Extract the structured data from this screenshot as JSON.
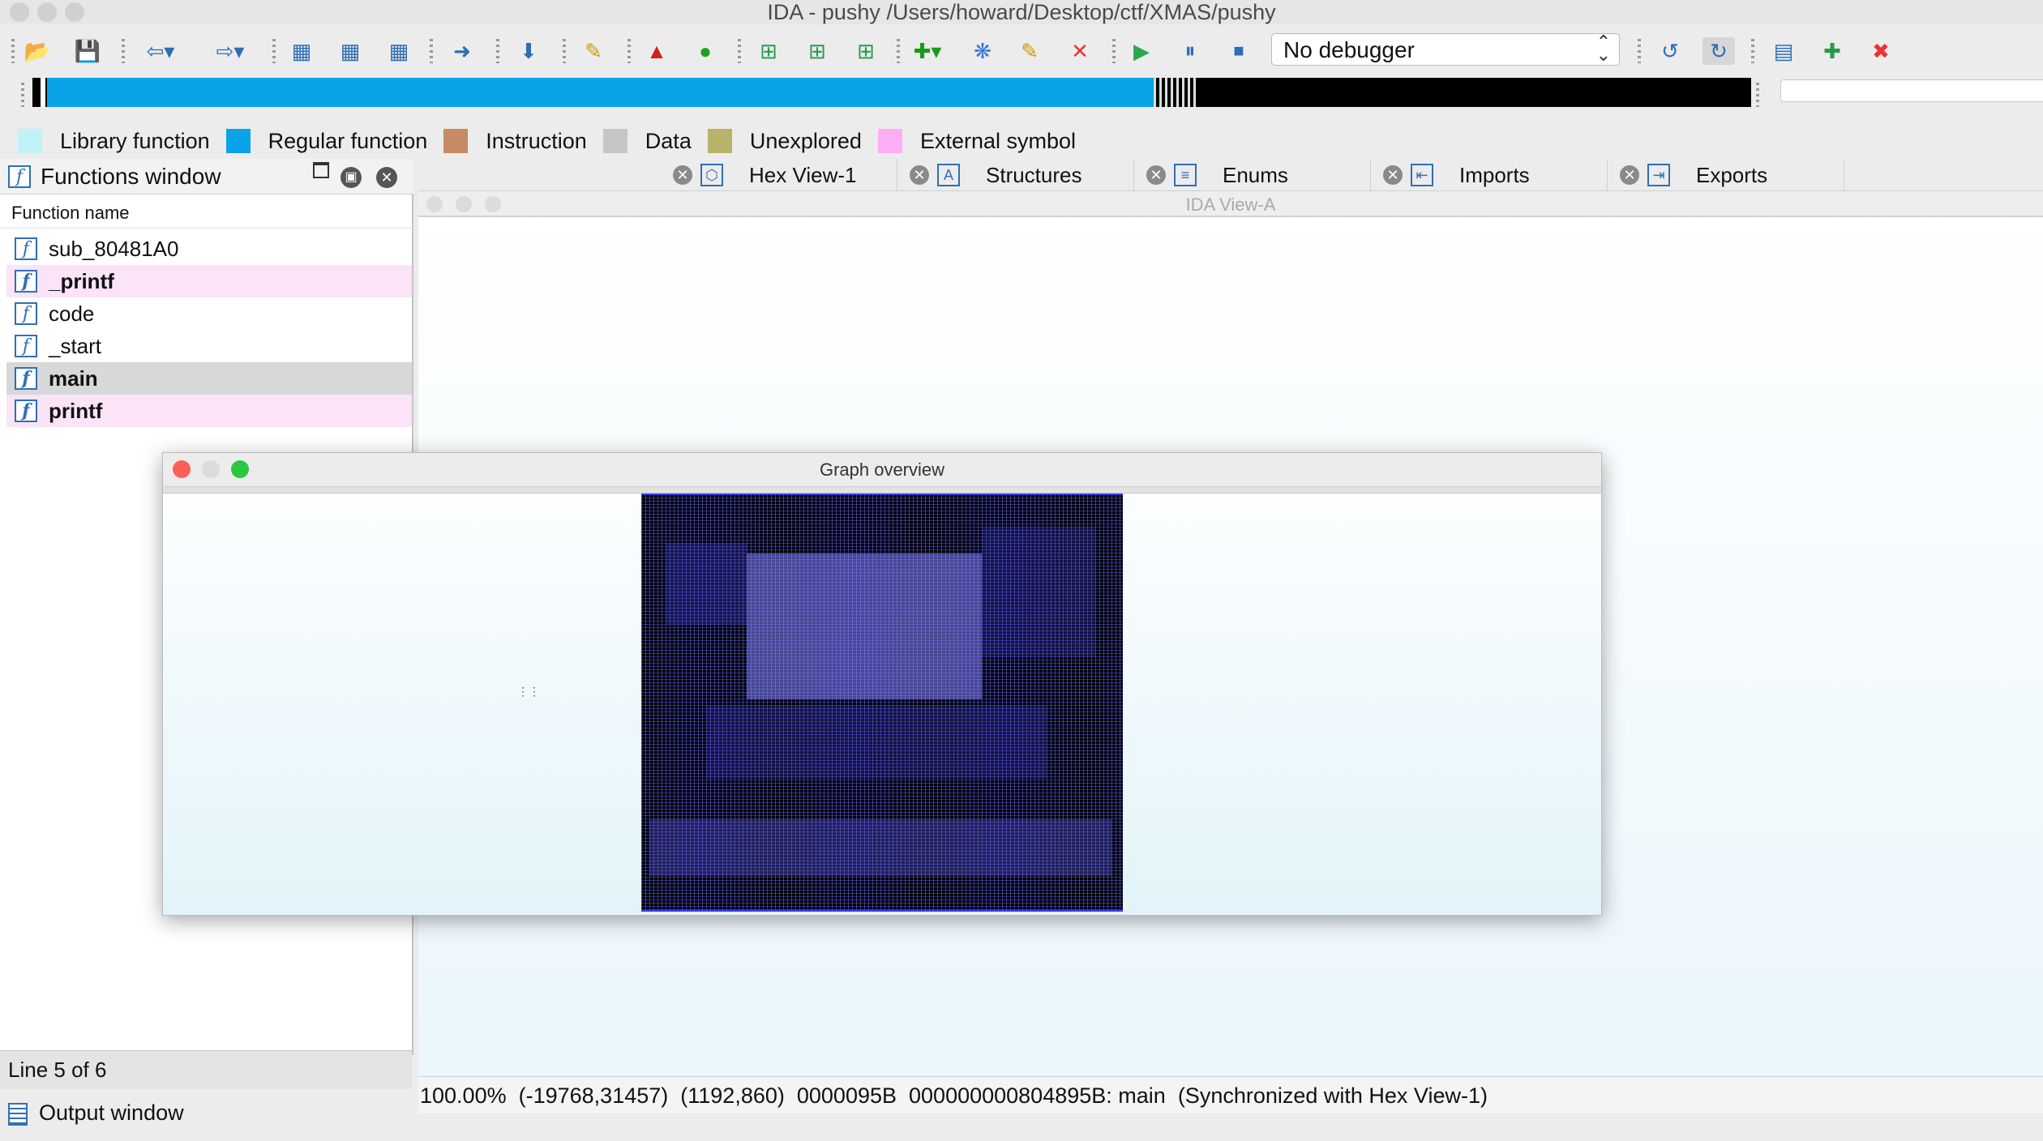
{
  "window": {
    "title": "IDA - pushy /Users/howard/Desktop/ctf/XMAS/pushy"
  },
  "toolbar": {
    "debugger_select": "No debugger",
    "icons": [
      "open-icon",
      "save-icon",
      "back-icon",
      "forward-icon",
      "text-search-icon",
      "binary-search-icon",
      "immediate-search-icon",
      "jump-icon",
      "jump-down-icon",
      "hide-icon",
      "warning-icon",
      "green-circle-icon",
      "add-segment-icon",
      "add-struct-icon",
      "add-enum-icon",
      "add-function-icon",
      "breakpoint-icon",
      "edit-icon",
      "delete-icon",
      "run-icon",
      "pause-icon",
      "stop-icon",
      "attach-icon",
      "detach-icon",
      "help-icon",
      "plugin-add-icon",
      "plugin-remove-icon"
    ]
  },
  "legend": {
    "items": [
      {
        "label": "Library function",
        "color": "#bff3f5"
      },
      {
        "label": "Regular function",
        "color": "#0aa3e8"
      },
      {
        "label": "Instruction",
        "color": "#c68a64"
      },
      {
        "label": "Data",
        "color": "#c6c6c6"
      },
      {
        "label": "Unexplored",
        "color": "#b8b36b"
      },
      {
        "label": "External symbol",
        "color": "#ffaef5"
      }
    ]
  },
  "functions": {
    "title": "Functions window",
    "column": "Function name",
    "rows": [
      {
        "name": "sub_80481A0",
        "bold": false,
        "bg": "#ffffff"
      },
      {
        "name": "_printf",
        "bold": true,
        "bg": "#fbe3f8"
      },
      {
        "name": "code",
        "bold": false,
        "bg": "#ffffff"
      },
      {
        "name": "_start",
        "bold": false,
        "bg": "#ffffff"
      },
      {
        "name": "main",
        "bold": true,
        "bg": "#d8d8d8"
      },
      {
        "name": "printf",
        "bold": true,
        "bg": "#fbe3f8"
      }
    ],
    "line_status": "Line 5 of 6"
  },
  "output": {
    "title": "Output window"
  },
  "tabs": [
    {
      "label": "Hex View-1"
    },
    {
      "label": "Structures"
    },
    {
      "label": "Enums"
    },
    {
      "label": "Imports"
    },
    {
      "label": "Exports"
    }
  ],
  "ida_view": {
    "title": "IDA View-A"
  },
  "graph_overview": {
    "title": "Graph overview"
  },
  "status_bar": {
    "zoom": "100.00%",
    "coords": "(-19768,31457)",
    "size": "(1192,860)",
    "offset": "0000095B",
    "address": "000000000804895B: main",
    "sync": "(Synchronized with Hex View-1)"
  }
}
